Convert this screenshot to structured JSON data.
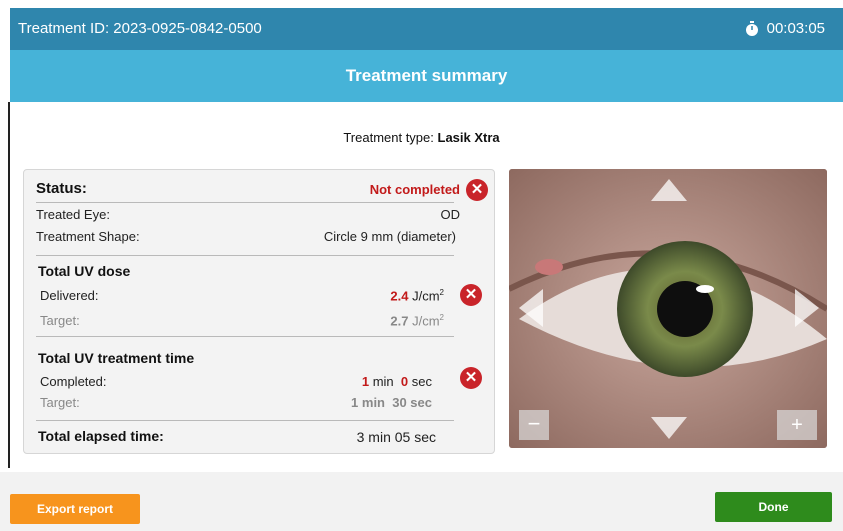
{
  "header": {
    "treatment_id": "Treatment ID: 2023-0925-0842-0500",
    "timer": "00:03:05",
    "timer_icon": "stopwatch-icon"
  },
  "title": "Treatment summary",
  "treatment_type": {
    "label": "Treatment type:",
    "value": "Lasik Xtra"
  },
  "status": {
    "label": "Status:",
    "value": "Not completed"
  },
  "treated_eye": {
    "label": "Treated Eye:",
    "value": "OD"
  },
  "treatment_shape": {
    "label": "Treatment Shape:",
    "value": "Circle 9 mm (diameter)"
  },
  "uv_dose": {
    "heading": "Total UV dose",
    "delivered_label": "Delivered:",
    "delivered_value": "2.4",
    "delivered_unit": "J/cm",
    "target_label": "Target:",
    "target_value": "2.7",
    "target_unit": "J/cm",
    "unit_exp": "2"
  },
  "uv_time": {
    "heading": "Total UV treatment time",
    "completed_label": "Completed:",
    "completed_min": "1",
    "min_unit": "min",
    "completed_sec": "0",
    "sec_unit": "sec",
    "target_label": "Target:",
    "target_value": "1 min  30 sec"
  },
  "elapsed": {
    "label": "Total elapsed time:",
    "value": "3 min 05 sec"
  },
  "buttons": {
    "export": "Export report",
    "done": "Done"
  },
  "camera": {
    "zoom_out": "−",
    "zoom_in": "+"
  },
  "colors": {
    "topbar": "#2f86ad",
    "titlebar": "#46b3d8",
    "error": "#c21a1a",
    "export": "#f7941d",
    "done": "#2e8b1c"
  }
}
